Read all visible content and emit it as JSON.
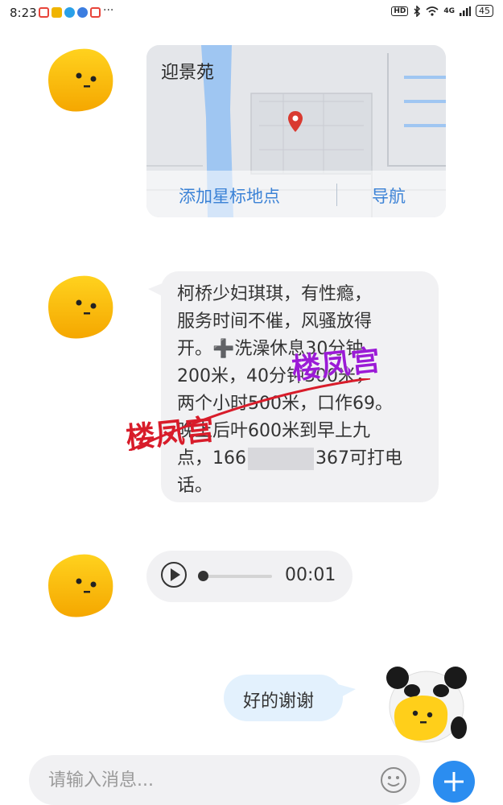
{
  "status_bar": {
    "time": "8:23",
    "overflow": "···",
    "network": "4G",
    "battery": "45",
    "notification_colors": [
      "#e8443a",
      "#f0b400",
      "#2aa0e8",
      "#3b7de0",
      "#e8443a"
    ]
  },
  "messages": [
    {
      "type": "location",
      "title": "迎景苑",
      "star_label": "添加星标地点",
      "navigate_label": "导航"
    },
    {
      "type": "text",
      "lines": [
        "柯桥少妇琪琪，有性瘾，",
        "服务时间不催，风骚放得",
        "开。➕洗澡休息30分钟",
        "200米，40分钟300米，",
        "两个小时500米，口作69。",
        "晚上后叶600米到早上九",
        "点，166",
        "367可打电",
        "话。"
      ]
    },
    {
      "type": "voice",
      "duration": "00:01"
    },
    {
      "type": "reply",
      "text": "好的谢谢"
    }
  ],
  "watermarks": [
    "楼凤宫",
    "楼凤宫"
  ],
  "input": {
    "placeholder": "请输入消息..."
  },
  "colors": {
    "accent": "#2b8df0",
    "map_link": "#3b82d6",
    "incoming_bubble": "#f1f1f3",
    "outgoing_bubble": "#e3f1fd",
    "watermark_red": "#d81c2a",
    "watermark_purple": "#9b1bd6"
  },
  "icons": [
    "avatar-yellow-blob",
    "map-pin-icon",
    "play-icon",
    "emoji-icon",
    "plus-icon",
    "panda-avatar"
  ]
}
